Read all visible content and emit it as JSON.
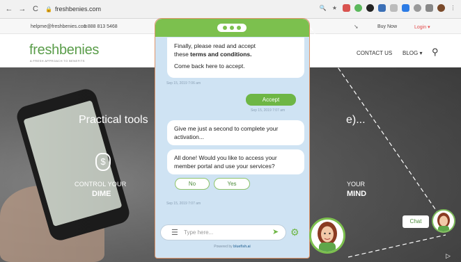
{
  "browser": {
    "back": "←",
    "forward": "→",
    "reload": "C",
    "url": "freshbenies.com"
  },
  "utility_bar": {
    "email": "helpme@freshbenies.com",
    "phone": "1 888 813 5468",
    "buy_now": "Buy Now",
    "login": "Login ▾"
  },
  "header": {
    "logo": "freshbenies",
    "tagline": "A FRESH APPROACH TO BENEFITS",
    "contact": "CONTACT US",
    "blog": "BLOG ▾"
  },
  "hero": {
    "title_left": "Practical tools",
    "title_right": "e)...",
    "dime_line1": "CONTROL YOUR",
    "dime_line2": "DIME",
    "mind_line1": "YOUR",
    "mind_line2": "MIND"
  },
  "chat": {
    "msg1_line1": "Finally, please read and accept",
    "msg1_line2_prefix": "these ",
    "msg1_line2_bold": "terms and conditions.",
    "msg1_line3": "Come back here to accept.",
    "ts1": "Sep 15, 2019 7:06 am",
    "accept": "Accept",
    "ts2": "Sep 15, 2019 7:07 am",
    "msg2_line1": "Give me just a second to complete your",
    "msg2_line2": "activation...",
    "msg3_line1": "All done! Would you like to access your",
    "msg3_line2": "member portal and use your services?",
    "no": "No",
    "yes": "Yes",
    "ts3": "Sep 15, 2019 7:07 am",
    "input_placeholder": "Type here...",
    "powered_prefix": "Powered by ",
    "powered_brand": "bluefish.ai",
    "launcher": "Chat"
  },
  "colors": {
    "brand_green": "#7cc04e",
    "chat_bg": "#cfe3f3",
    "login_red": "#e24a4a"
  }
}
